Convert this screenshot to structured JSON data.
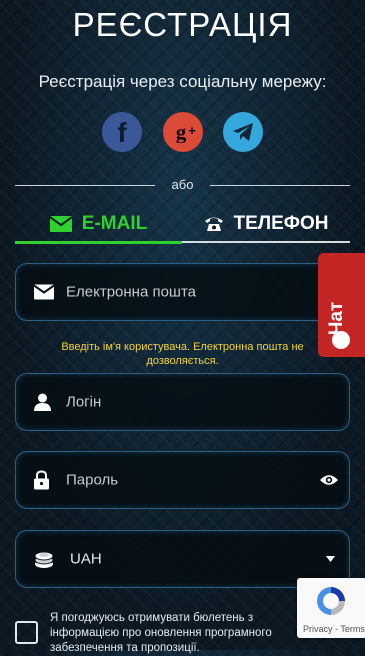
{
  "header": {
    "title": "РЕЄСТРАЦІЯ",
    "subtitle": "Реєстрація через соціальну мережу:"
  },
  "social": [
    {
      "name": "facebook",
      "icon": "facebook-icon",
      "color": "#3b5998"
    },
    {
      "name": "google-plus",
      "icon": "google-plus-icon",
      "color": "#dc4a38"
    },
    {
      "name": "telegram",
      "icon": "telegram-icon",
      "color": "#34a7dd"
    }
  ],
  "divider": {
    "or_text": "або"
  },
  "tabs": [
    {
      "label": "E-MAIL",
      "icon": "envelope-icon",
      "active": true,
      "color": "#2ed12e"
    },
    {
      "label": "ТЕЛЕФОН",
      "icon": "phone-icon",
      "active": false
    }
  ],
  "form": {
    "email_placeholder": "Електронна пошта",
    "email_error": "Введіть ім'я користувача. Електронна пошта не дозволяється.",
    "login_placeholder": "Логін",
    "password_placeholder": "Пароль",
    "currency_value": "UAH",
    "newsletter_text": "Я погоджуюсь отримувати бюлетень з інформацією про оновлення програмного забезпечення та пропозиції."
  },
  "chat": {
    "label": "Чат",
    "color": "#c42525"
  },
  "captcha": {
    "links": "Privacy - Terms"
  }
}
